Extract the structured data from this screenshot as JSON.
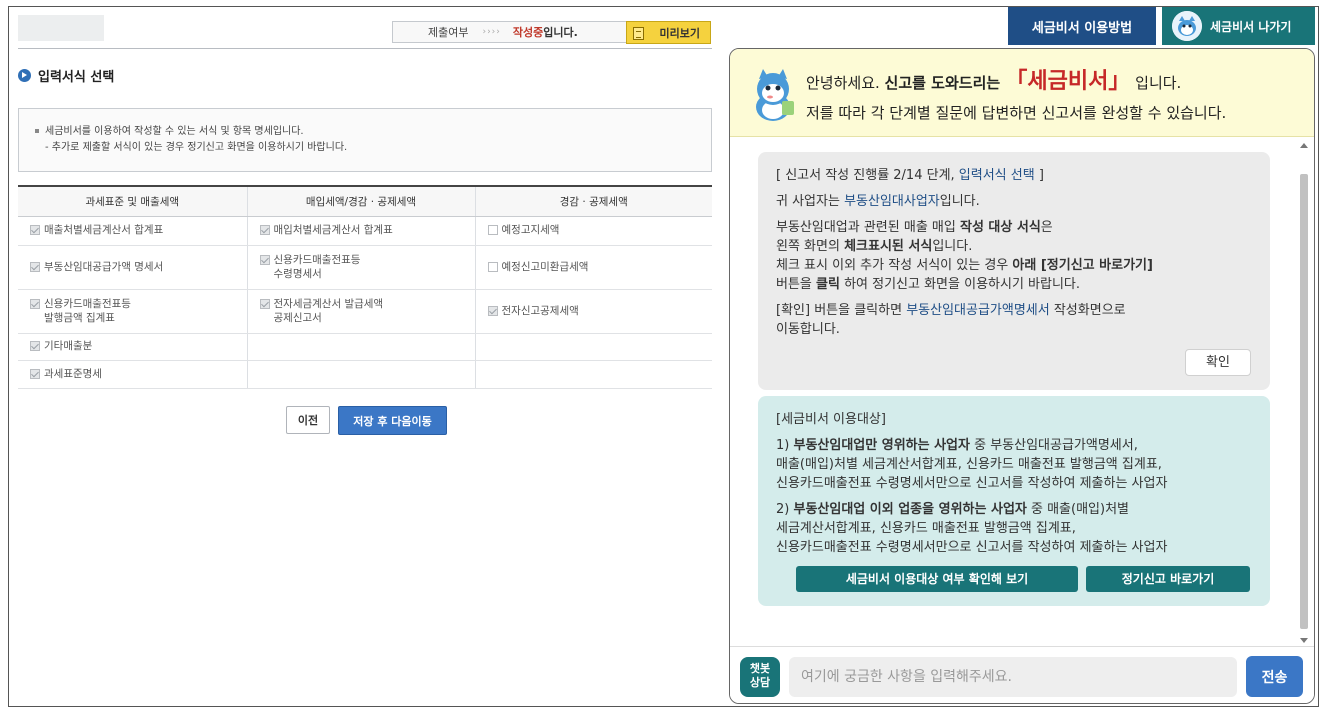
{
  "topbar": {
    "status_label": "제출여부",
    "status_arrows": "››››",
    "status_value": "작성중",
    "status_suffix": "입니다.",
    "preview_label": "미리보기",
    "guide_label": "세금비서 이용방법",
    "exit_label": "세금비서 나가기"
  },
  "section": {
    "title": "입력서식 선택",
    "info_line1": "세금비서를 이용하여 작성할 수 있는 서식 및 항목 명세입니다.",
    "info_line2": "- 추가로 제출할 서식이 있는 경우 정기신고 화면을 이용하시기 바랍니다."
  },
  "table": {
    "headers": [
      "과세표준 및 매출세액",
      "매입세액/경감 · 공제세액",
      "경감 · 공제세액"
    ],
    "rows": [
      [
        {
          "label": "매출처별세금계산서 합계표",
          "checked": true
        },
        {
          "label": "매입처별세금계산서 합계표",
          "checked": true
        },
        {
          "label": "예정고지세액",
          "checked": false
        }
      ],
      [
        {
          "label": "부동산임대공급가액 명세서",
          "checked": true
        },
        {
          "label": "신용카드매출전표등",
          "label2": "수령명세서",
          "checked": true
        },
        {
          "label": "예정신고미환급세액",
          "checked": false
        }
      ],
      [
        {
          "label": "신용카드매출전표등",
          "label2": "발행금액 집계표",
          "checked": true
        },
        {
          "label": "전자세금계산서 발급세액",
          "label2": "공제신고서",
          "checked": true
        },
        {
          "label": "전자신고공제세액",
          "checked": true
        }
      ],
      [
        {
          "label": "기타매출분",
          "checked": true
        }
      ],
      [
        {
          "label": "과세표준명세",
          "checked": true
        }
      ]
    ]
  },
  "buttons": {
    "prev": "이전",
    "save_next": "저장 후 다음이동"
  },
  "chat": {
    "greet_pre": "안녕하세요. ",
    "greet_bold": "신고를 도와드리는 ",
    "greet_brand": "「세금비서」",
    "greet_post": " 입니다.",
    "greet_line2": "저를 따라 각 단계별 질문에 답변하면 신고서를 완성할 수 있습니다.",
    "msg1": {
      "progress_pre": "[ 신고서 작성 진행률 2/14 단계, ",
      "progress_step": "입력서식 선택",
      "progress_post": " ]",
      "biz_pre": "귀 사업자는 ",
      "biz_type": "부동산임대사업자",
      "biz_post": "입니다.",
      "p2_a": "부동산임대업과 관련된 매출 매입 ",
      "p2_b": "작성 대상 서식",
      "p2_c": "은",
      "p2_d": "왼쪽 화면의 ",
      "p2_e": "체크표시된 서식",
      "p2_f": "입니다.",
      "p2_g": "체크 표시 이외 추가 작성 서식이 있는 경우 ",
      "p2_h": "아래 [정기신고 바로가기]",
      "p2_i": "버튼을 ",
      "p2_j": "클릭",
      "p2_k": " 하여 정기신고 화면을 이용하시기 바랍니다.",
      "p3_a": "[확인] 버튼을 클릭하면 ",
      "p3_b": "부동산임대공급가액명세서",
      "p3_c": " 작성화면으로",
      "p3_d": "이동합니다.",
      "ok": "확인"
    },
    "msg2": {
      "title": "[세금비서 이용대상]",
      "i1_a": "1) ",
      "i1_b": "부동산임대업만 영위하는 사업자",
      "i1_c": " 중 부동산임대공급가액명세서,",
      "i1_d": "매출(매입)처별 세금계산서합계표, 신용카드 매출전표 발행금액 집계표,",
      "i1_e": "신용카드매출전표 수령명세서만으로 신고서를 작성하여 제출하는 사업자",
      "i2_a": "2) ",
      "i2_b": "부동산임대업 이외 업종을 영위하는 사업자",
      "i2_c": " 중 매출(매입)처별",
      "i2_d": "세금계산서합계표, 신용카드 매출전표 발행금액 집계표,",
      "i2_e": "신용카드매출전표 수령명세서만으로 신고서를 작성하여 제출하는 사업자",
      "btn_check": "세금비서 이용대상 여부 확인해 보기",
      "btn_regular": "정기신고 바로가기"
    },
    "badge_line1": "챗봇",
    "badge_line2": "상담",
    "input_placeholder": "여기에 궁금한 사항을 입력해주세요.",
    "send": "전송"
  },
  "colors": {
    "navy": "#1f4e86",
    "teal": "#197478",
    "brand_red": "#c62828",
    "save_blue": "#3b77c6",
    "preview_yellow": "#f5d23e"
  }
}
